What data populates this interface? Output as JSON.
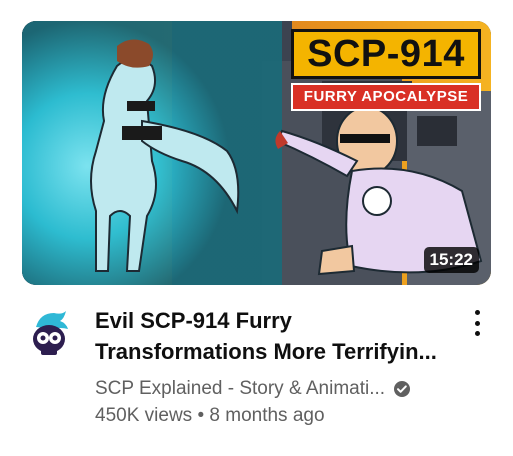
{
  "video": {
    "thumbnail_title": "SCP-914",
    "thumbnail_subtitle": "FURRY APOCALYPSE",
    "duration": "15:22",
    "title_line1": "Evil SCP-914 Furry",
    "title_line2": "Transformations More Terrifyin...",
    "channel": "SCP Explained - Story & Animati...",
    "views": "450K views",
    "separator": "•",
    "age": "8 months ago"
  },
  "icons": {
    "avatar": "skull-avatar-icon",
    "verified": "verified-check-icon",
    "more": "more-vert-icon"
  },
  "colors": {
    "badge_yellow": "#f4b400",
    "badge_red": "#d93025",
    "glow_cyan": "#38d6e8",
    "text_primary": "#0f0f0f",
    "text_secondary": "#606060"
  }
}
